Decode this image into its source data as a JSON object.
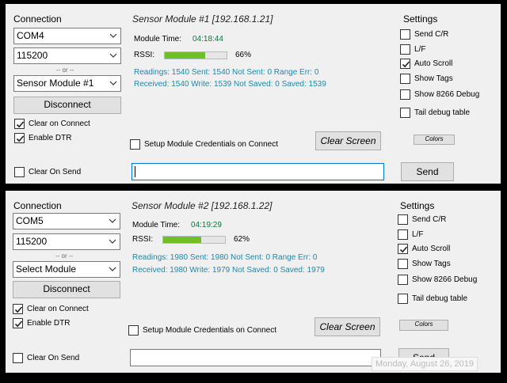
{
  "panels": [
    {
      "connection_label": "Connection",
      "port": "COM4",
      "baud": "115200",
      "or_label": "-- or --",
      "module_select": "Sensor Module #1",
      "disconnect_label": "Disconnect",
      "clear_on_connect": {
        "label": "Clear on Connect",
        "checked": true
      },
      "enable_dtr": {
        "label": "Enable DTR",
        "checked": true
      },
      "clear_on_send": {
        "label": "Clear On Send",
        "checked": false
      },
      "module_title": "Sensor Module #1 [192.168.1.21]",
      "module_time_label": "Module Time:",
      "module_time": "04:18:44",
      "rssi_label": "RSSI:",
      "rssi_percent": "66%",
      "rssi_value": 66,
      "stats_line1": "Readings: 1540  Sent: 1540  Not Sent: 0 Range Err: 0",
      "stats_line2": "Received: 1540 Write: 1539  Not Saved: 0 Saved: 1539",
      "setup_credentials": {
        "label": "Setup Module Credentials on Connect",
        "checked": false
      },
      "clear_screen_label": "Clear Screen",
      "send_input_value": "",
      "send_label": "Send",
      "settings_label": "Settings",
      "settings": [
        {
          "label": "Send C/R",
          "checked": false
        },
        {
          "label": "L/F",
          "checked": false
        },
        {
          "label": "Auto Scroll",
          "checked": true
        },
        {
          "label": "Show Tags",
          "checked": false
        },
        {
          "label": "Show 8266 Debug",
          "checked": false
        },
        {
          "label": "Tail debug table",
          "checked": false
        }
      ],
      "colors_label": "Colors"
    },
    {
      "connection_label": "Connection",
      "port": "COM5",
      "baud": "115200",
      "or_label": "-- or --",
      "module_select": "Select Module",
      "disconnect_label": "Disconnect",
      "clear_on_connect": {
        "label": "Clear on Connect",
        "checked": true
      },
      "enable_dtr": {
        "label": "Enable DTR",
        "checked": true
      },
      "clear_on_send": {
        "label": "Clear On Send",
        "checked": false
      },
      "module_title": "Sensor Module #2 [192.168.1.22]",
      "module_time_label": "Module Time:",
      "module_time": "04:19:29",
      "rssi_label": "RSSI:",
      "rssi_percent": "62%",
      "rssi_value": 62,
      "stats_line1": "Readings: 1980  Sent: 1980  Not Sent: 0 Range Err: 0",
      "stats_line2": "Received: 1980 Write: 1979  Not Saved: 0 Saved: 1979",
      "setup_credentials": {
        "label": "Setup Module Credentials on Connect",
        "checked": false
      },
      "clear_screen_label": "Clear Screen",
      "send_input_value": "",
      "send_label": "Send",
      "settings_label": "Settings",
      "settings": [
        {
          "label": "Send C/R",
          "checked": false
        },
        {
          "label": "L/F",
          "checked": false
        },
        {
          "label": "Auto Scroll",
          "checked": true
        },
        {
          "label": "Show Tags",
          "checked": false
        },
        {
          "label": "Show 8266 Debug",
          "checked": false
        },
        {
          "label": "Tail debug table",
          "checked": false
        }
      ],
      "colors_label": "Colors"
    }
  ],
  "date_overlay": "Monday, August 26, 2019",
  "colors": {
    "rssi_fill": "#6fbf2b",
    "stats_text": "#1a8ab0",
    "time_text": "#0a7a3a",
    "focus_border": "#0078d7"
  }
}
